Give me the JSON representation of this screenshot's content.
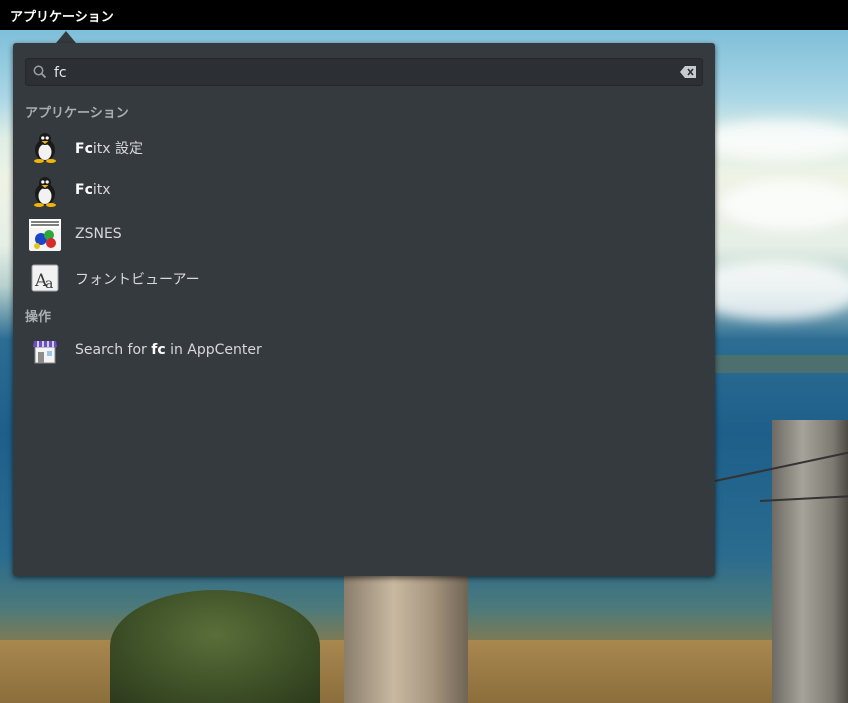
{
  "panel": {
    "applications_button": "アプリケーション"
  },
  "search": {
    "value": "fc",
    "placeholder": ""
  },
  "sections": {
    "applications_header": "アプリケーション",
    "actions_header": "操作"
  },
  "results": [
    {
      "match": "Fc",
      "rest": "itx 設定",
      "icon": "tux-penguin-icon"
    },
    {
      "match": "Fc",
      "rest": "itx",
      "icon": "tux-penguin-icon"
    },
    {
      "match": "",
      "rest": "ZSNES",
      "icon": "zsnes-icon"
    },
    {
      "match": "",
      "rest": "フォントビューアー",
      "icon": "font-viewer-icon"
    }
  ],
  "actions": [
    {
      "prefix": "Search for ",
      "match": "fc",
      "suffix": " in AppCenter",
      "icon": "appcenter-icon"
    }
  ],
  "colors": {
    "panel_bg": "#000000",
    "popover_bg": "#353a3e",
    "text": "#d6d8d9",
    "header_text": "#a9aeb2"
  }
}
